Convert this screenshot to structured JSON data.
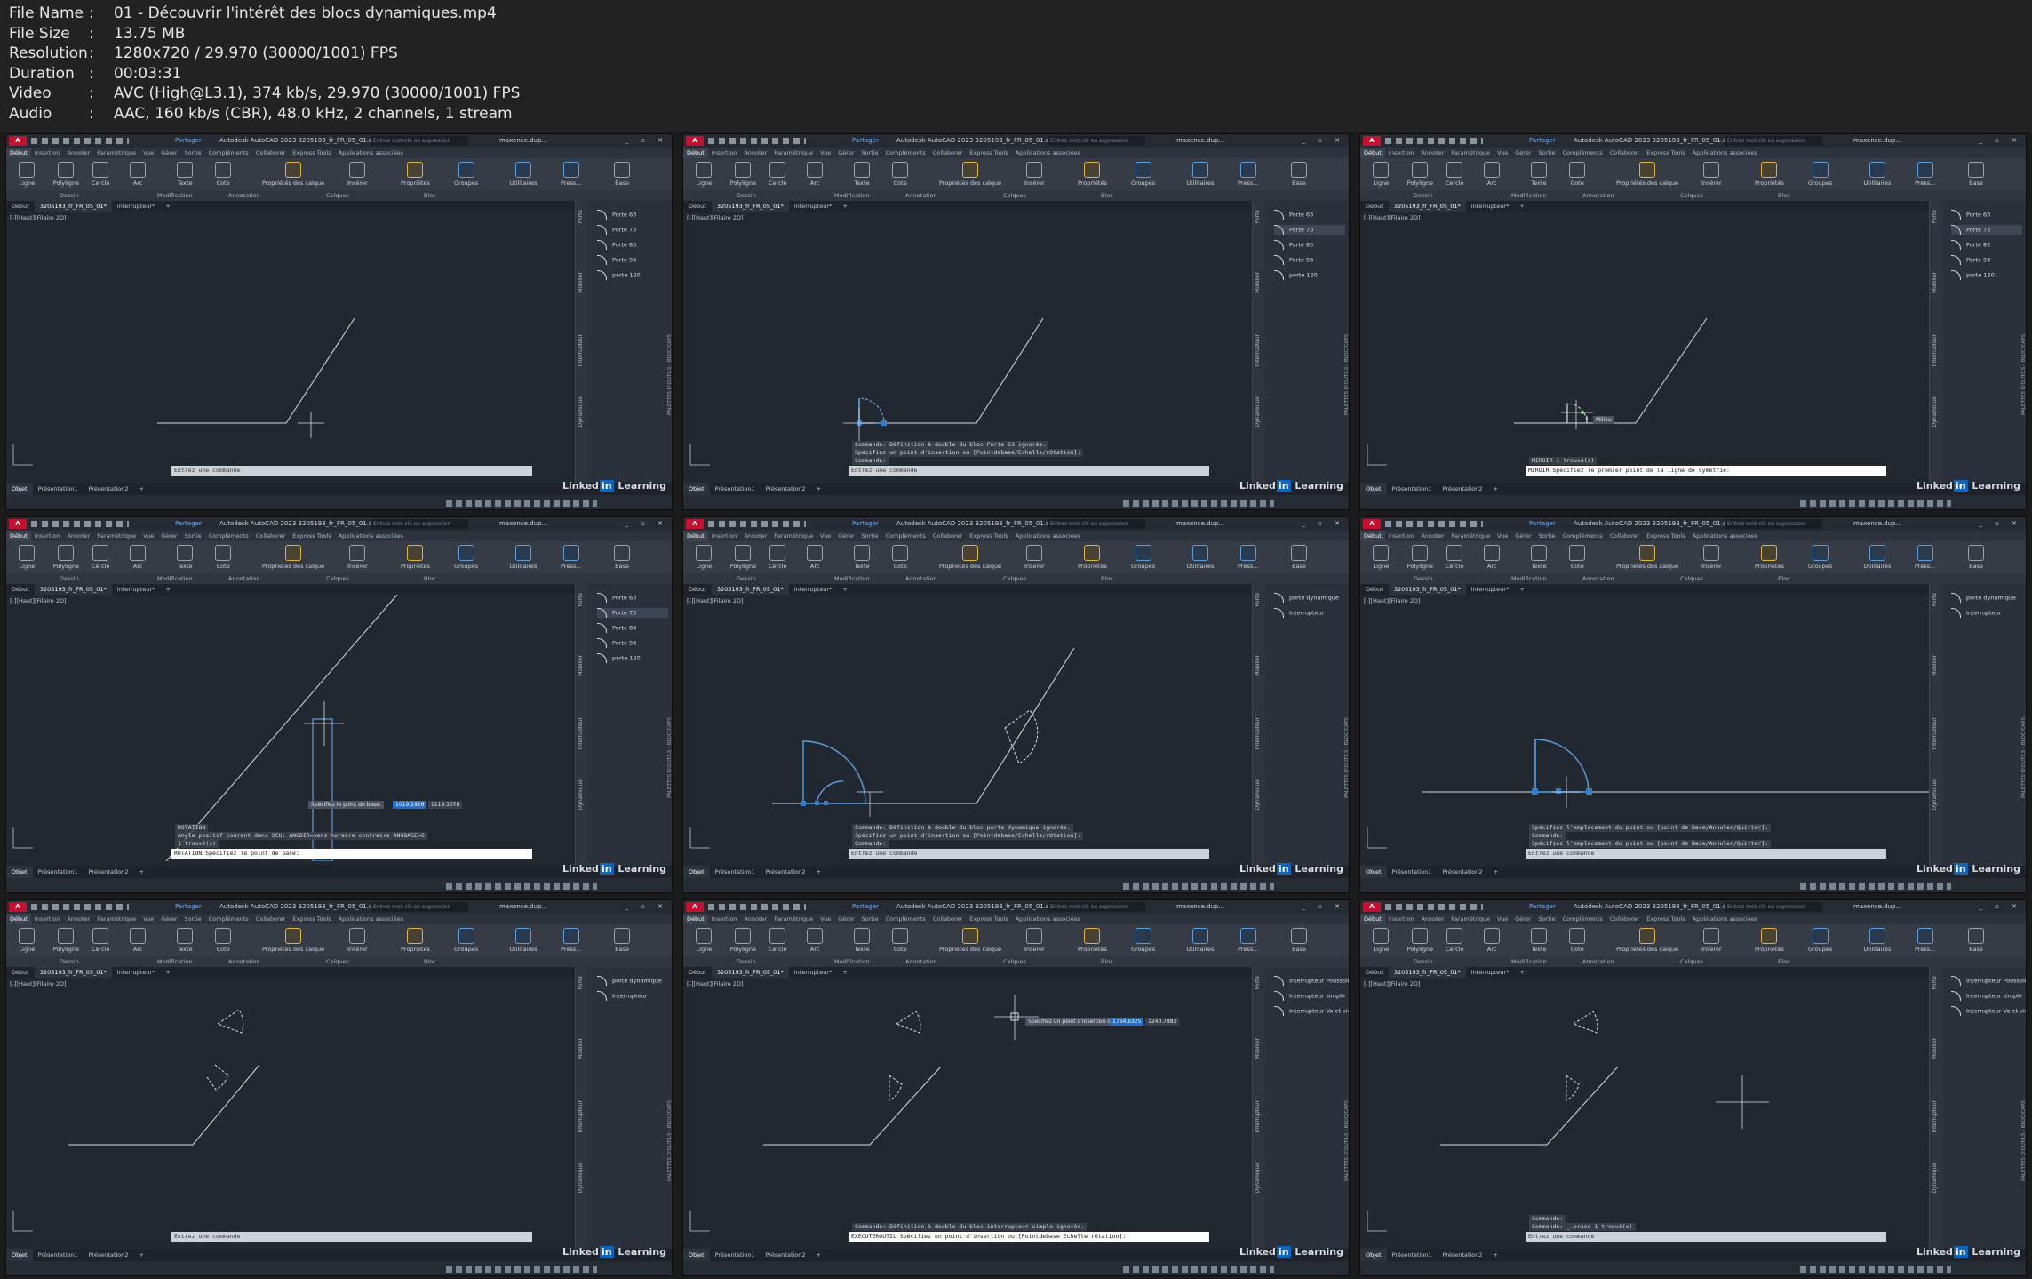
{
  "info": [
    {
      "key": "File Name",
      "value": "01 - Découvrir l'intérêt des blocs dynamiques.mp4"
    },
    {
      "key": "File Size",
      "value": "13.75 MB"
    },
    {
      "key": "Resolution",
      "value": "1280x720 / 29.970 (30000/1001) FPS"
    },
    {
      "key": "Duration",
      "value": "00:03:31"
    },
    {
      "key": "Video",
      "value": "AVC (High@L3.1), 374 kb/s, 29.970 (30000/1001) FPS"
    },
    {
      "key": "Audio",
      "value": "AAC, 160 kb/s (CBR), 48.0 kHz, 2 channels, 1 stream"
    }
  ],
  "common": {
    "logo": "A CAD",
    "share": "Partager",
    "app_title": "Autodesk AutoCAD 2023   3205193_fr_FR_05_01.dwg",
    "search_placeholder": "Entrez mot-clé ou expression",
    "user": "maxence.dup...",
    "window_buttons": "_ ▫ ✕",
    "ribbon_tabs": [
      "Début",
      "Insertion",
      "Annoter",
      "Paramétrique",
      "Vue",
      "Gérer",
      "Sortie",
      "Compléments",
      "Collaborer",
      "Express Tools",
      "Applications associées"
    ],
    "ribbon_buttons": [
      "Ligne",
      "Polyligne",
      "Cercle",
      "Arc",
      "Texte",
      "Cote",
      "Propriétés des calque",
      "Insérer",
      "Propriétés",
      "Groupes",
      "Utilitaires",
      "Press...",
      "Base"
    ],
    "panels": [
      "Dessin",
      "Modification",
      "Annotation",
      "Calques",
      "Bloc"
    ],
    "doc_tabs": [
      "Début",
      "3205193_fr_FR_05_01*",
      "interrupteur*"
    ],
    "view_label": "[-][Haut][Filaire 2D]",
    "layout_tabs": [
      "Objet",
      "Présentation1",
      "Présentation2"
    ],
    "cmd_placeholder": "Entrez une commande",
    "palette_strip": [
      "Porte",
      "Mobilier",
      "Interrupteur",
      "Dynamique"
    ],
    "palette_side_label": "PALETTES D'OUTILS - BLOC/CAPS",
    "brand_a": "Linked",
    "brand_b": "in",
    "brand_c": "Learning"
  },
  "tiles": [
    {
      "palette": [
        "Porte 63",
        "Porte 73",
        "Porte 83",
        "Porte 93",
        "porte 120"
      ],
      "selected": -1,
      "cmd_history": [],
      "cmd_line": "",
      "tooltip": null
    },
    {
      "palette": [
        "Porte 63",
        "Porte 73",
        "Porte 83",
        "Porte 93",
        "porte 120"
      ],
      "selected": 1,
      "cmd_history": [
        "Commande:  Définition à double du bloc Porte 63  ignorée.",
        "Spécifiez un point d'insertion ou [Pointdebase/Echelle/rOtation]:",
        "Commande:"
      ],
      "cmd_line": "",
      "tooltip": null
    },
    {
      "palette": [
        "Porte 63",
        "Porte 73",
        "Porte 83",
        "Porte 93",
        "porte 120"
      ],
      "selected": 1,
      "cmd_history": [
        "MIROIR 1 trouvé(s)"
      ],
      "cmd_line": "MIROIR Spécifiez le premier point de la ligne de symétrie:",
      "tooltip": {
        "text": "Milieu",
        "val1": "",
        "val2": ""
      }
    },
    {
      "palette": [
        "Porte 63",
        "Porte 73",
        "Porte 83",
        "Porte 93",
        "porte 120"
      ],
      "selected": 1,
      "cmd_history": [
        "ROTATION",
        "Angle positif courant dans SCU: ANGDIR=sens horaire contraire ANGBASE=0",
        "1 trouvé(s)"
      ],
      "cmd_line": "ROTATION Spécifiez le point de base:",
      "tooltip": {
        "text": "Spécifiez le point de base:",
        "val1": "1019.2926",
        "val2": "1119.3078"
      }
    },
    {
      "palette": [
        "porte dynamique",
        "Interrupteur"
      ],
      "selected": -1,
      "cmd_history": [
        "Commande:  Définition à double du bloc porte dynamique  ignorée.",
        "Spécifiez un point d'insertion ou [Pointdebase/Echelle/rOtation]:",
        "Commande:"
      ],
      "cmd_line": "",
      "tooltip": null
    },
    {
      "palette": [
        "porte dynamique",
        "Interrupteur"
      ],
      "selected": -1,
      "cmd_history": [
        "Spécifiez l'emplacement du point ou [point de Base/Annuler/Quitter]:",
        "Commande:",
        "Spécifiez l'emplacement du point ou [point de Base/Annuler/Quitter]:"
      ],
      "cmd_line": "",
      "tooltip": null
    },
    {
      "palette": [
        "porte dynamique",
        "Interrupteur"
      ],
      "selected": -1,
      "cmd_history": [],
      "cmd_line": "",
      "tooltip": null
    },
    {
      "palette": [
        "Interrupteur Poussoir",
        "Interrupteur simple",
        "Interrupteur Va et vient"
      ],
      "selected": -1,
      "cmd_history": [
        "Commande:  Définition à double du bloc interrupteur simple  ignorée."
      ],
      "cmd_line": "EXECUTEROUTIL Spécifiez un point d'insertion ou [Pointdebase Echelle rOtation]:",
      "tooltip": {
        "text": "Spécifiez un point d'insertion ou",
        "val1": "1764.6325",
        "val2": "1240.7883"
      }
    },
    {
      "palette": [
        "Interrupteur Poussoir",
        "Interrupteur simple",
        "Interrupteur Va et vient"
      ],
      "selected": -1,
      "cmd_history": [
        "Commande:",
        "Commande: _.erase 1 trouvé(s)"
      ],
      "cmd_line": "",
      "tooltip": null
    }
  ]
}
